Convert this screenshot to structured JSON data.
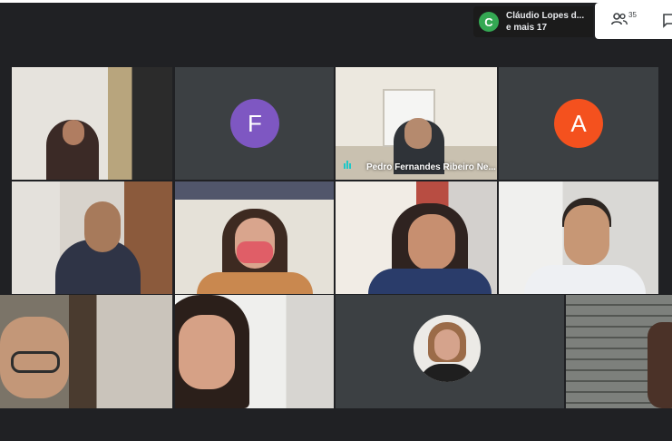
{
  "header": {
    "presenter_initial": "C",
    "presenter_name": "Cláudio Lopes d...",
    "presenter_more": "e mais 17",
    "people_count": "35"
  },
  "tiles": [
    {
      "name": "",
      "kind": "video",
      "bg": "#c9c3b6"
    },
    {
      "name": "",
      "kind": "avatar",
      "initial": "F",
      "color": "#7e57c2"
    },
    {
      "name": "Pedro Fernandes Ribeiro Ne...",
      "kind": "video",
      "bg": "#dcd7cd"
    },
    {
      "name": "",
      "kind": "avatar",
      "initial": "A",
      "color": "#f4511e"
    },
    {
      "name": "",
      "kind": "video",
      "bg": "#bdb6aa"
    },
    {
      "name": "",
      "kind": "video",
      "bg": "#c7c0b5"
    },
    {
      "name": "",
      "kind": "video",
      "bg": "#d6d1c8"
    },
    {
      "name": "",
      "kind": "video",
      "bg": "#dedcd8"
    },
    {
      "name": "",
      "kind": "video",
      "bg": "#8e857a"
    },
    {
      "name": "",
      "kind": "video",
      "bg": "#a89d90"
    },
    {
      "name": "",
      "kind": "photo-avatar",
      "bg": "#3c4043"
    },
    {
      "name": "",
      "kind": "video",
      "bg": "#6c6f6c"
    }
  ]
}
